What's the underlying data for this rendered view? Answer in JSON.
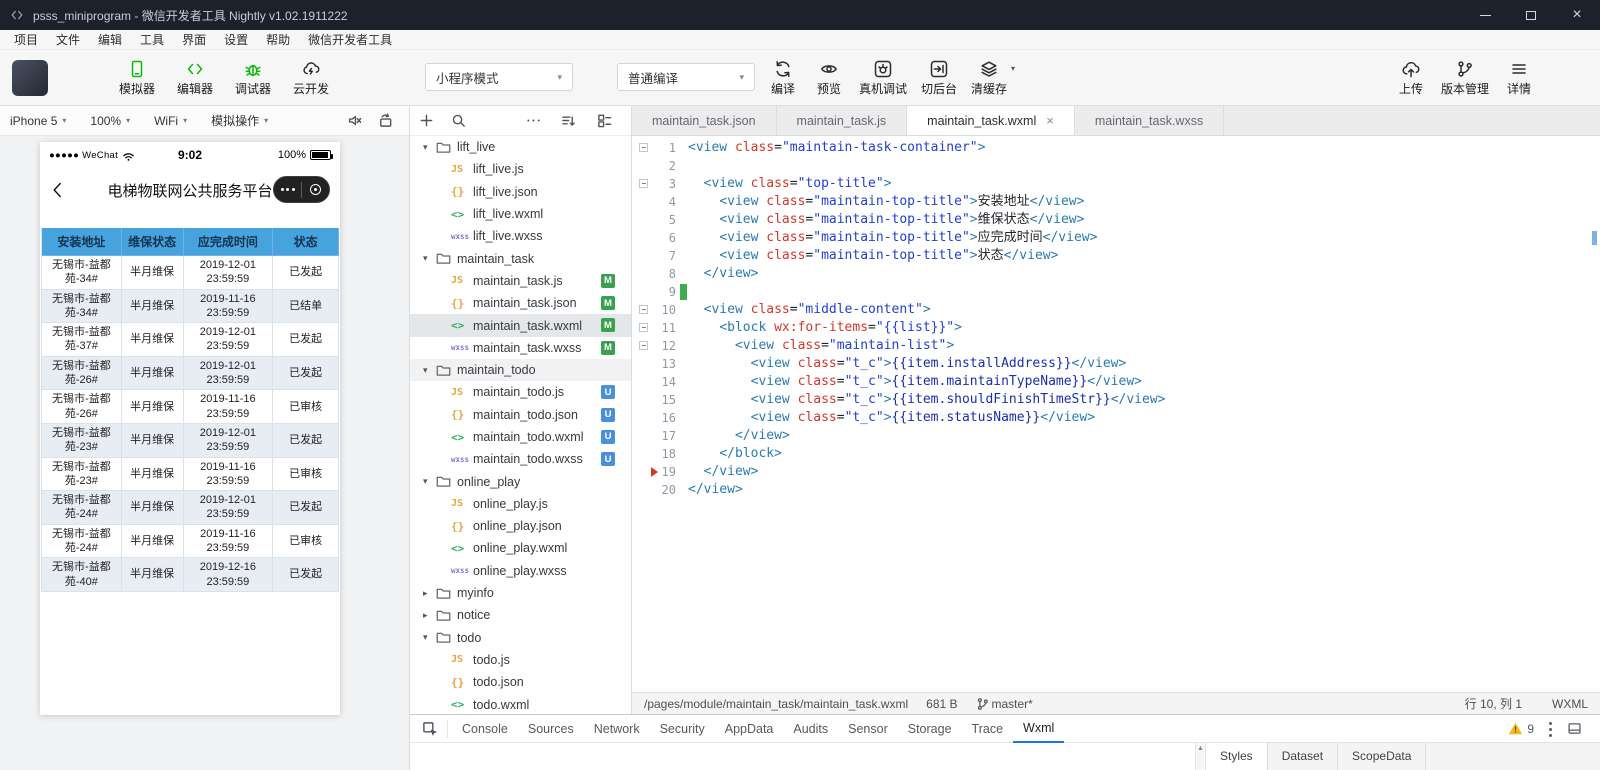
{
  "colors": {
    "accent_green": "#09bb07",
    "table_header_blue": "#47a3de",
    "badge_modified": "#38a24f",
    "badge_untracked": "#4b8fd8",
    "active_tab_underline": "#1a73e8"
  },
  "window": {
    "title": "psss_miniprogram - 微信开发者工具 Nightly v1.02.1911222"
  },
  "menu": {
    "items": [
      "项目",
      "文件",
      "编辑",
      "工具",
      "界面",
      "设置",
      "帮助",
      "微信开发者工具"
    ]
  },
  "toolbar": {
    "left_buttons": [
      {
        "label": "模拟器",
        "icon": "simulator-icon",
        "color": "#09bb07"
      },
      {
        "label": "编辑器",
        "icon": "editor-icon",
        "color": "#09bb07"
      },
      {
        "label": "调试器",
        "icon": "debugger-icon",
        "color": "#09bb07"
      },
      {
        "label": "云开发",
        "icon": "cloud-dev-icon",
        "color": "#2b2b2b"
      }
    ],
    "mode_select": "小程序模式",
    "compile_select": "普通编译",
    "action_buttons": [
      {
        "label": "编译",
        "icon": "compile-icon"
      },
      {
        "label": "预览",
        "icon": "preview-icon"
      },
      {
        "label": "真机调试",
        "icon": "remote-debug-icon"
      },
      {
        "label": "切后台",
        "icon": "background-icon"
      },
      {
        "label": "清缓存",
        "icon": "clear-cache-icon",
        "has_dropdown": true
      }
    ],
    "right_buttons": [
      {
        "label": "上传",
        "icon": "upload-icon"
      },
      {
        "label": "版本管理",
        "icon": "version-icon"
      },
      {
        "label": "详情",
        "icon": "details-icon"
      }
    ]
  },
  "simulator": {
    "toolbar_dropdowns": [
      "iPhone 5",
      "100%",
      "WiFi",
      "模拟操作"
    ],
    "phone": {
      "status": {
        "carrier": "●●●●● WeChat",
        "time": "9:02",
        "battery": "100%"
      },
      "nav_title": "电梯物联网公共服务平台",
      "table": {
        "headers": [
          "安装地址",
          "维保状态",
          "应完成时间",
          "状态"
        ],
        "rows": [
          {
            "address": "无锡市-益都苑-34#",
            "type": "半月维保",
            "time": "2019-12-01 23:59:59",
            "status": "已发起"
          },
          {
            "address": "无锡市-益都苑-34#",
            "type": "半月维保",
            "time": "2019-11-16 23:59:59",
            "status": "已结单"
          },
          {
            "address": "无锡市-益都苑-37#",
            "type": "半月维保",
            "time": "2019-12-01 23:59:59",
            "status": "已发起"
          },
          {
            "address": "无锡市-益都苑-26#",
            "type": "半月维保",
            "time": "2019-12-01 23:59:59",
            "status": "已发起"
          },
          {
            "address": "无锡市-益都苑-26#",
            "type": "半月维保",
            "time": "2019-11-16 23:59:59",
            "status": "已审核"
          },
          {
            "address": "无锡市-益都苑-23#",
            "type": "半月维保",
            "time": "2019-12-01 23:59:59",
            "status": "已发起"
          },
          {
            "address": "无锡市-益都苑-23#",
            "type": "半月维保",
            "time": "2019-11-16 23:59:59",
            "status": "已审核"
          },
          {
            "address": "无锡市-益都苑-24#",
            "type": "半月维保",
            "time": "2019-12-01 23:59:59",
            "status": "已发起"
          },
          {
            "address": "无锡市-益都苑-24#",
            "type": "半月维保",
            "time": "2019-11-16 23:59:59",
            "status": "已审核"
          },
          {
            "address": "无锡市-益都苑-40#",
            "type": "半月维保",
            "time": "2019-12-16 23:59:59",
            "status": "已发起"
          }
        ]
      }
    }
  },
  "file_tree": {
    "items": [
      {
        "kind": "folder",
        "name": "lift_live",
        "state": "expanded"
      },
      {
        "kind": "file",
        "name": "lift_live.js",
        "ft": "js"
      },
      {
        "kind": "file",
        "name": "lift_live.json",
        "ft": "json"
      },
      {
        "kind": "file",
        "name": "lift_live.wxml",
        "ft": "wxml"
      },
      {
        "kind": "file",
        "name": "lift_live.wxss",
        "ft": "wxss"
      },
      {
        "kind": "folder",
        "name": "maintain_task",
        "state": "expanded"
      },
      {
        "kind": "file",
        "name": "maintain_task.js",
        "ft": "js",
        "badge": "M"
      },
      {
        "kind": "file",
        "name": "maintain_task.json",
        "ft": "json",
        "badge": "M"
      },
      {
        "kind": "file",
        "name": "maintain_task.wxml",
        "ft": "wxml",
        "badge": "M",
        "selected": true
      },
      {
        "kind": "file",
        "name": "maintain_task.wxss",
        "ft": "wxss",
        "badge": "M"
      },
      {
        "kind": "folder",
        "name": "maintain_todo",
        "state": "expanded",
        "hover": true
      },
      {
        "kind": "file",
        "name": "maintain_todo.js",
        "ft": "js",
        "badge": "U"
      },
      {
        "kind": "file",
        "name": "maintain_todo.json",
        "ft": "json",
        "badge": "U"
      },
      {
        "kind": "file",
        "name": "maintain_todo.wxml",
        "ft": "wxml",
        "badge": "U"
      },
      {
        "kind": "file",
        "name": "maintain_todo.wxss",
        "ft": "wxss",
        "badge": "U"
      },
      {
        "kind": "folder",
        "name": "online_play",
        "state": "expanded"
      },
      {
        "kind": "file",
        "name": "online_play.js",
        "ft": "js"
      },
      {
        "kind": "file",
        "name": "online_play.json",
        "ft": "json"
      },
      {
        "kind": "file",
        "name": "online_play.wxml",
        "ft": "wxml"
      },
      {
        "kind": "file",
        "name": "online_play.wxss",
        "ft": "wxss"
      },
      {
        "kind": "folder",
        "name": "myinfo",
        "state": "collapsed"
      },
      {
        "kind": "folder",
        "name": "notice",
        "state": "collapsed"
      },
      {
        "kind": "folder",
        "name": "todo",
        "state": "expanded"
      },
      {
        "kind": "file",
        "name": "todo.js",
        "ft": "js"
      },
      {
        "kind": "file",
        "name": "todo.json",
        "ft": "json"
      },
      {
        "kind": "file",
        "name": "todo.wxml",
        "ft": "wxml"
      }
    ]
  },
  "editor": {
    "tabs": [
      {
        "label": "maintain_task.json"
      },
      {
        "label": "maintain_task.js"
      },
      {
        "label": "maintain_task.wxml",
        "active": true,
        "closable": true
      },
      {
        "label": "maintain_task.wxss"
      }
    ],
    "code_lines": [
      "<view class=\"maintain-task-container\">",
      "",
      "  <view class=\"top-title\">",
      "    <view class=\"maintain-top-title\">安装地址</view>",
      "    <view class=\"maintain-top-title\">维保状态</view>",
      "    <view class=\"maintain-top-title\">应完成时间</view>",
      "    <view class=\"maintain-top-title\">状态</view>",
      "  </view>",
      "",
      "  <view class=\"middle-content\">",
      "    <block wx:for-items=\"{{list}}\">",
      "      <view class=\"maintain-list\">",
      "        <view class=\"t_c\">{{item.installAddress}}</view>",
      "        <view class=\"t_c\">{{item.maintainTypeName}}</view>",
      "        <view class=\"t_c\">{{item.shouldFinishTimeStr}}</view>",
      "        <view class=\"t_c\">{{item.statusName}}</view>",
      "      </view>",
      "    </block>",
      "  </view>",
      "</view>"
    ],
    "gutter": {
      "fold_lines": [
        1,
        3,
        10,
        11,
        12
      ],
      "added_lines": [
        9
      ],
      "arrow_line": 19
    },
    "status": {
      "path": "/pages/module/maintain_task/maintain_task.wxml",
      "size": "681 B",
      "branch": "master*",
      "position": "行 10, 列 1",
      "mode": "WXML"
    }
  },
  "debugger": {
    "tabs": [
      "Console",
      "Sources",
      "Network",
      "Security",
      "AppData",
      "Audits",
      "Sensor",
      "Storage",
      "Trace",
      "Wxml"
    ],
    "active_tab": "Wxml",
    "warning_count": "9",
    "subtabs": [
      "Styles",
      "Dataset",
      "ScopeData"
    ]
  }
}
